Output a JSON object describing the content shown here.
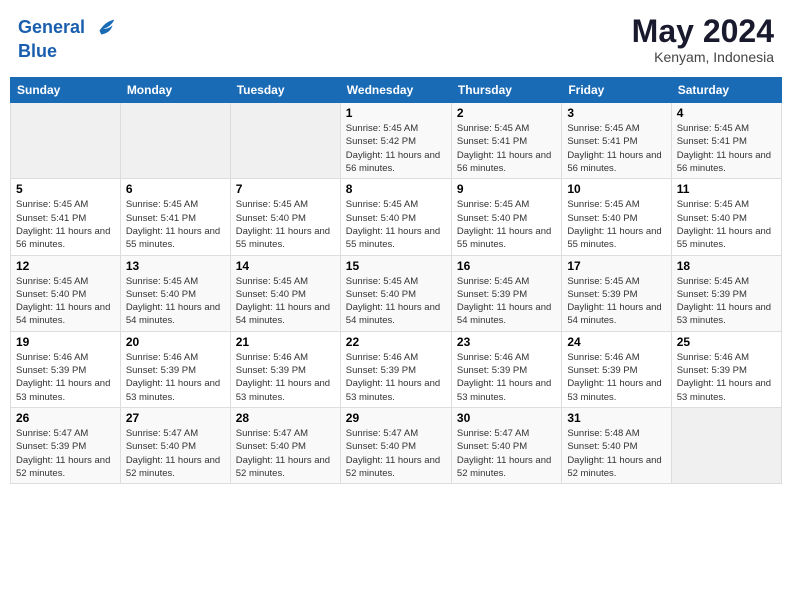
{
  "header": {
    "logo_line1": "General",
    "logo_line2": "Blue",
    "month": "May 2024",
    "location": "Kenyam, Indonesia"
  },
  "days_of_week": [
    "Sunday",
    "Monday",
    "Tuesday",
    "Wednesday",
    "Thursday",
    "Friday",
    "Saturday"
  ],
  "weeks": [
    [
      {
        "num": "",
        "info": ""
      },
      {
        "num": "",
        "info": ""
      },
      {
        "num": "",
        "info": ""
      },
      {
        "num": "1",
        "info": "Sunrise: 5:45 AM\nSunset: 5:42 PM\nDaylight: 11 hours and 56 minutes."
      },
      {
        "num": "2",
        "info": "Sunrise: 5:45 AM\nSunset: 5:41 PM\nDaylight: 11 hours and 56 minutes."
      },
      {
        "num": "3",
        "info": "Sunrise: 5:45 AM\nSunset: 5:41 PM\nDaylight: 11 hours and 56 minutes."
      },
      {
        "num": "4",
        "info": "Sunrise: 5:45 AM\nSunset: 5:41 PM\nDaylight: 11 hours and 56 minutes."
      }
    ],
    [
      {
        "num": "5",
        "info": "Sunrise: 5:45 AM\nSunset: 5:41 PM\nDaylight: 11 hours and 56 minutes."
      },
      {
        "num": "6",
        "info": "Sunrise: 5:45 AM\nSunset: 5:41 PM\nDaylight: 11 hours and 55 minutes."
      },
      {
        "num": "7",
        "info": "Sunrise: 5:45 AM\nSunset: 5:40 PM\nDaylight: 11 hours and 55 minutes."
      },
      {
        "num": "8",
        "info": "Sunrise: 5:45 AM\nSunset: 5:40 PM\nDaylight: 11 hours and 55 minutes."
      },
      {
        "num": "9",
        "info": "Sunrise: 5:45 AM\nSunset: 5:40 PM\nDaylight: 11 hours and 55 minutes."
      },
      {
        "num": "10",
        "info": "Sunrise: 5:45 AM\nSunset: 5:40 PM\nDaylight: 11 hours and 55 minutes."
      },
      {
        "num": "11",
        "info": "Sunrise: 5:45 AM\nSunset: 5:40 PM\nDaylight: 11 hours and 55 minutes."
      }
    ],
    [
      {
        "num": "12",
        "info": "Sunrise: 5:45 AM\nSunset: 5:40 PM\nDaylight: 11 hours and 54 minutes."
      },
      {
        "num": "13",
        "info": "Sunrise: 5:45 AM\nSunset: 5:40 PM\nDaylight: 11 hours and 54 minutes."
      },
      {
        "num": "14",
        "info": "Sunrise: 5:45 AM\nSunset: 5:40 PM\nDaylight: 11 hours and 54 minutes."
      },
      {
        "num": "15",
        "info": "Sunrise: 5:45 AM\nSunset: 5:40 PM\nDaylight: 11 hours and 54 minutes."
      },
      {
        "num": "16",
        "info": "Sunrise: 5:45 AM\nSunset: 5:39 PM\nDaylight: 11 hours and 54 minutes."
      },
      {
        "num": "17",
        "info": "Sunrise: 5:45 AM\nSunset: 5:39 PM\nDaylight: 11 hours and 54 minutes."
      },
      {
        "num": "18",
        "info": "Sunrise: 5:45 AM\nSunset: 5:39 PM\nDaylight: 11 hours and 53 minutes."
      }
    ],
    [
      {
        "num": "19",
        "info": "Sunrise: 5:46 AM\nSunset: 5:39 PM\nDaylight: 11 hours and 53 minutes."
      },
      {
        "num": "20",
        "info": "Sunrise: 5:46 AM\nSunset: 5:39 PM\nDaylight: 11 hours and 53 minutes."
      },
      {
        "num": "21",
        "info": "Sunrise: 5:46 AM\nSunset: 5:39 PM\nDaylight: 11 hours and 53 minutes."
      },
      {
        "num": "22",
        "info": "Sunrise: 5:46 AM\nSunset: 5:39 PM\nDaylight: 11 hours and 53 minutes."
      },
      {
        "num": "23",
        "info": "Sunrise: 5:46 AM\nSunset: 5:39 PM\nDaylight: 11 hours and 53 minutes."
      },
      {
        "num": "24",
        "info": "Sunrise: 5:46 AM\nSunset: 5:39 PM\nDaylight: 11 hours and 53 minutes."
      },
      {
        "num": "25",
        "info": "Sunrise: 5:46 AM\nSunset: 5:39 PM\nDaylight: 11 hours and 53 minutes."
      }
    ],
    [
      {
        "num": "26",
        "info": "Sunrise: 5:47 AM\nSunset: 5:39 PM\nDaylight: 11 hours and 52 minutes."
      },
      {
        "num": "27",
        "info": "Sunrise: 5:47 AM\nSunset: 5:40 PM\nDaylight: 11 hours and 52 minutes."
      },
      {
        "num": "28",
        "info": "Sunrise: 5:47 AM\nSunset: 5:40 PM\nDaylight: 11 hours and 52 minutes."
      },
      {
        "num": "29",
        "info": "Sunrise: 5:47 AM\nSunset: 5:40 PM\nDaylight: 11 hours and 52 minutes."
      },
      {
        "num": "30",
        "info": "Sunrise: 5:47 AM\nSunset: 5:40 PM\nDaylight: 11 hours and 52 minutes."
      },
      {
        "num": "31",
        "info": "Sunrise: 5:48 AM\nSunset: 5:40 PM\nDaylight: 11 hours and 52 minutes."
      },
      {
        "num": "",
        "info": ""
      }
    ]
  ]
}
